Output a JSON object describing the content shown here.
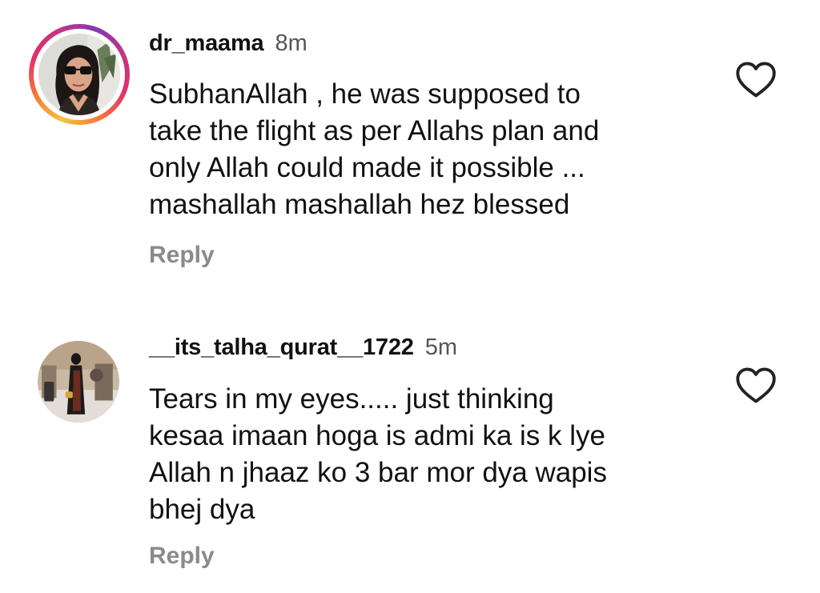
{
  "comments": [
    {
      "username": "dr_maama",
      "time": "8m",
      "text": "SubhanAllah , he was supposed to\ntake the flight as per Allahs plan and\nonly Allah could made it possible ...\nmashallah mashallah hez blessed",
      "reply_label": "Reply",
      "has_story_ring": true,
      "like_icon": "heart-outline-icon"
    },
    {
      "username": "__its_talha_qurat__1722",
      "time": "5m",
      "text": "Tears in my eyes..... just thinking\nkesaa imaan hoga is admi ka is k lye\nAllah n jhaaz ko 3 bar mor dya wapis\nbhej dya",
      "reply_label": "Reply",
      "has_story_ring": false,
      "like_icon": "heart-outline-icon"
    }
  ],
  "colors": {
    "text": "#111111",
    "muted": "#8a8a8a",
    "time": "#555555",
    "background": "#ffffff"
  }
}
